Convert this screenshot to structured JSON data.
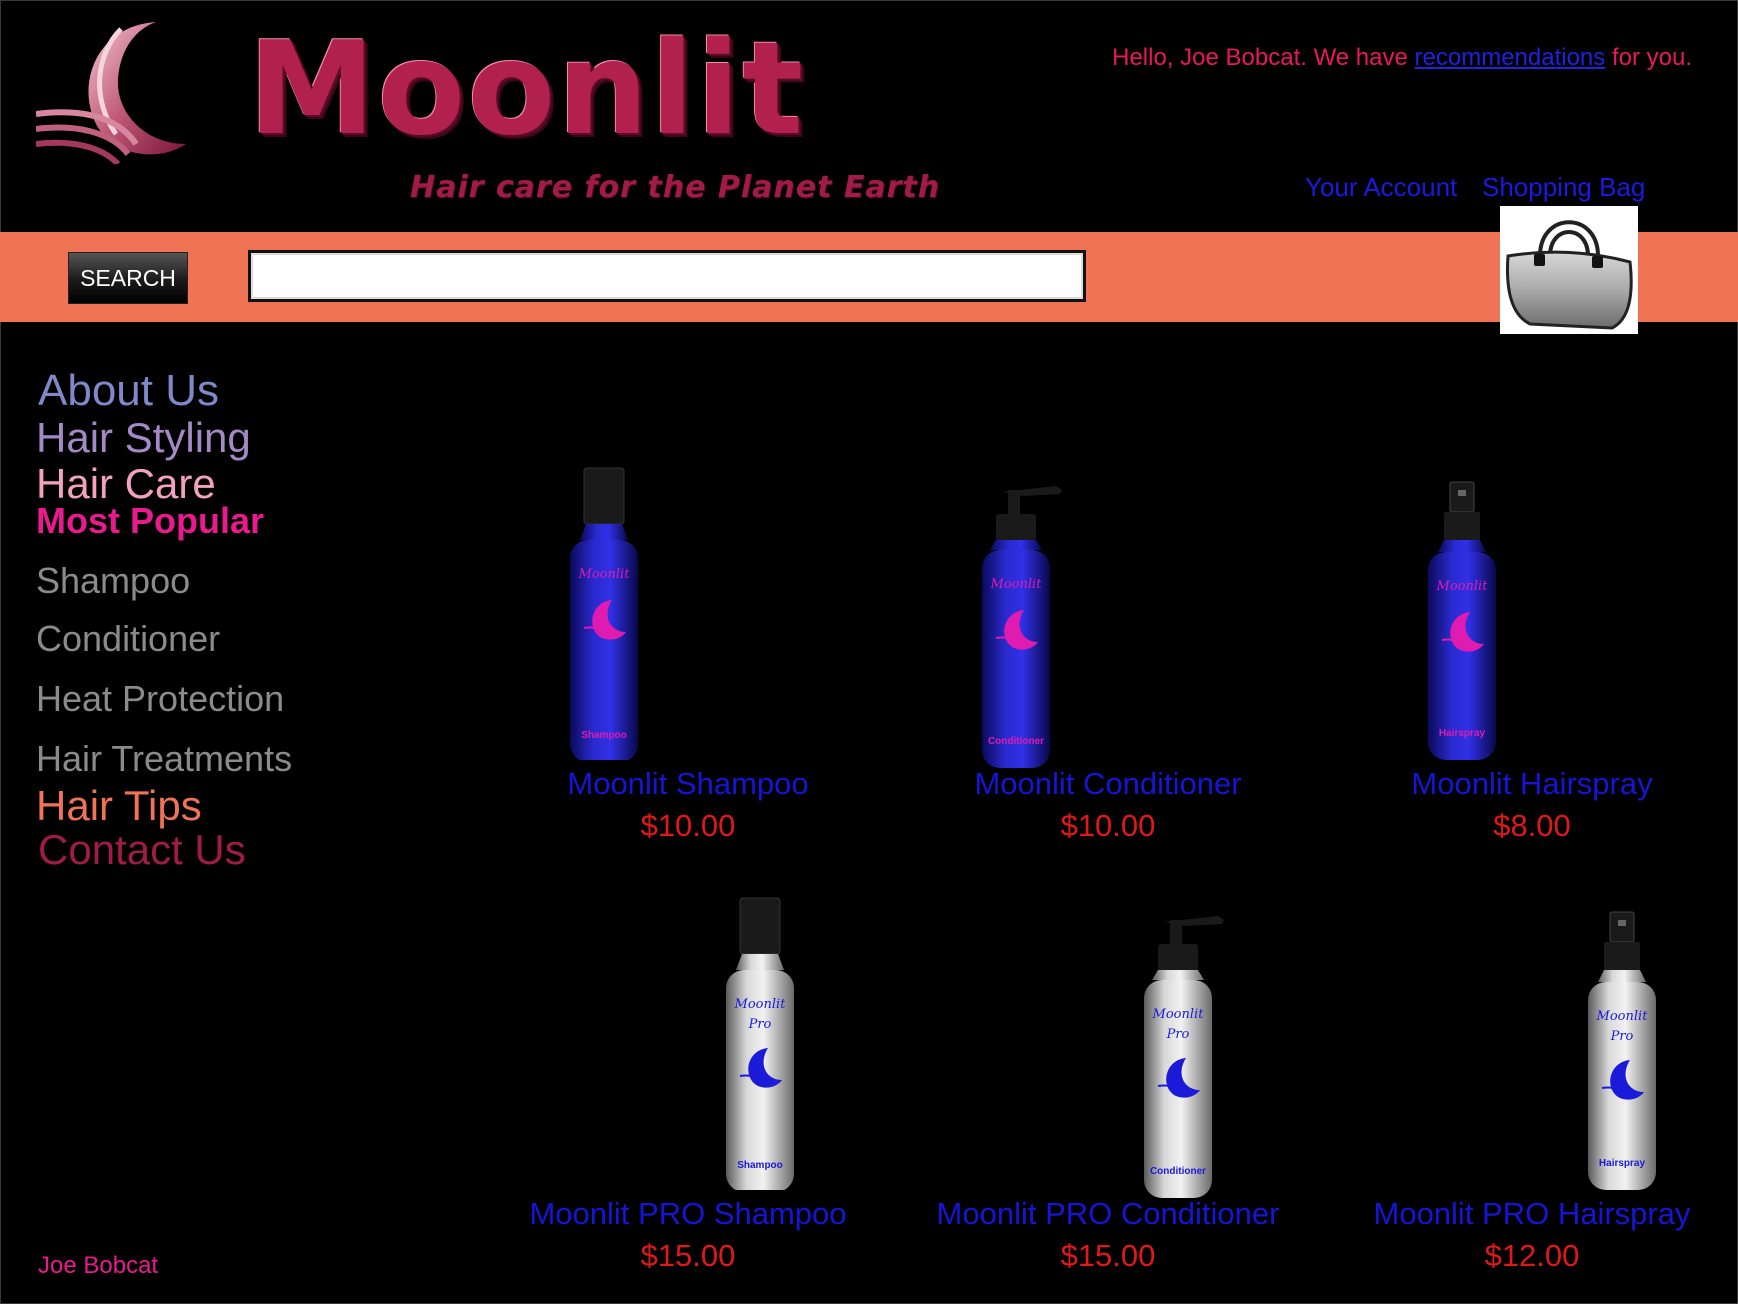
{
  "brand": {
    "name": "Moonlit",
    "tagline": "Hair care for the Planet Earth"
  },
  "header": {
    "greeting_prefix": "Hello, Joe Bobcat. We have ",
    "greeting_link": "recommendations",
    "greeting_suffix": " for you.",
    "your_account": "Your Account",
    "shopping_bag": "Shopping Bag"
  },
  "search": {
    "button_label": "SEARCH",
    "value": "",
    "placeholder": ""
  },
  "sidebar": {
    "items": [
      {
        "label": "About Us"
      },
      {
        "label": "Hair Styling"
      },
      {
        "label": "Hair Care"
      },
      {
        "label": "Most Popular"
      },
      {
        "label": "Shampoo"
      },
      {
        "label": "Conditioner"
      },
      {
        "label": "Heat Protection"
      },
      {
        "label": "Hair Treatments"
      },
      {
        "label": "Hair Tips"
      },
      {
        "label": "Contact Us"
      }
    ]
  },
  "footer": {
    "user_name": "Joe Bobcat"
  },
  "products": [
    {
      "name": "Moonlit Shampoo",
      "price": "$10.00",
      "bottle_label": "Shampoo",
      "bottle_brand": "Moonlit",
      "type": "cap",
      "color": "blue"
    },
    {
      "name": "Moonlit Conditioner",
      "price": "$10.00",
      "bottle_label": "Conditioner",
      "bottle_brand": "Moonlit",
      "type": "pump",
      "color": "blue"
    },
    {
      "name": "Moonlit Hairspray",
      "price": "$8.00",
      "bottle_label": "Hairspray",
      "bottle_brand": "Moonlit",
      "type": "spray",
      "color": "blue"
    },
    {
      "name": "Moonlit PRO Shampoo",
      "price": "$15.00",
      "bottle_label": "Shampoo",
      "bottle_brand": "Moonlit Pro",
      "type": "cap",
      "color": "silver"
    },
    {
      "name": "Moonlit PRO Conditioner",
      "price": "$15.00",
      "bottle_label": "Conditioner",
      "bottle_brand": "Moonlit Pro",
      "type": "pump",
      "color": "silver"
    },
    {
      "name": "Moonlit PRO Hairspray",
      "price": "$12.00",
      "bottle_label": "Hairspray",
      "bottle_brand": "Moonlit Pro",
      "type": "spray",
      "color": "silver"
    }
  ],
  "colors": {
    "accent_strip": "#f07355",
    "brand": "#b1204f",
    "product_name": "#1515d8",
    "price": "#e01818"
  }
}
